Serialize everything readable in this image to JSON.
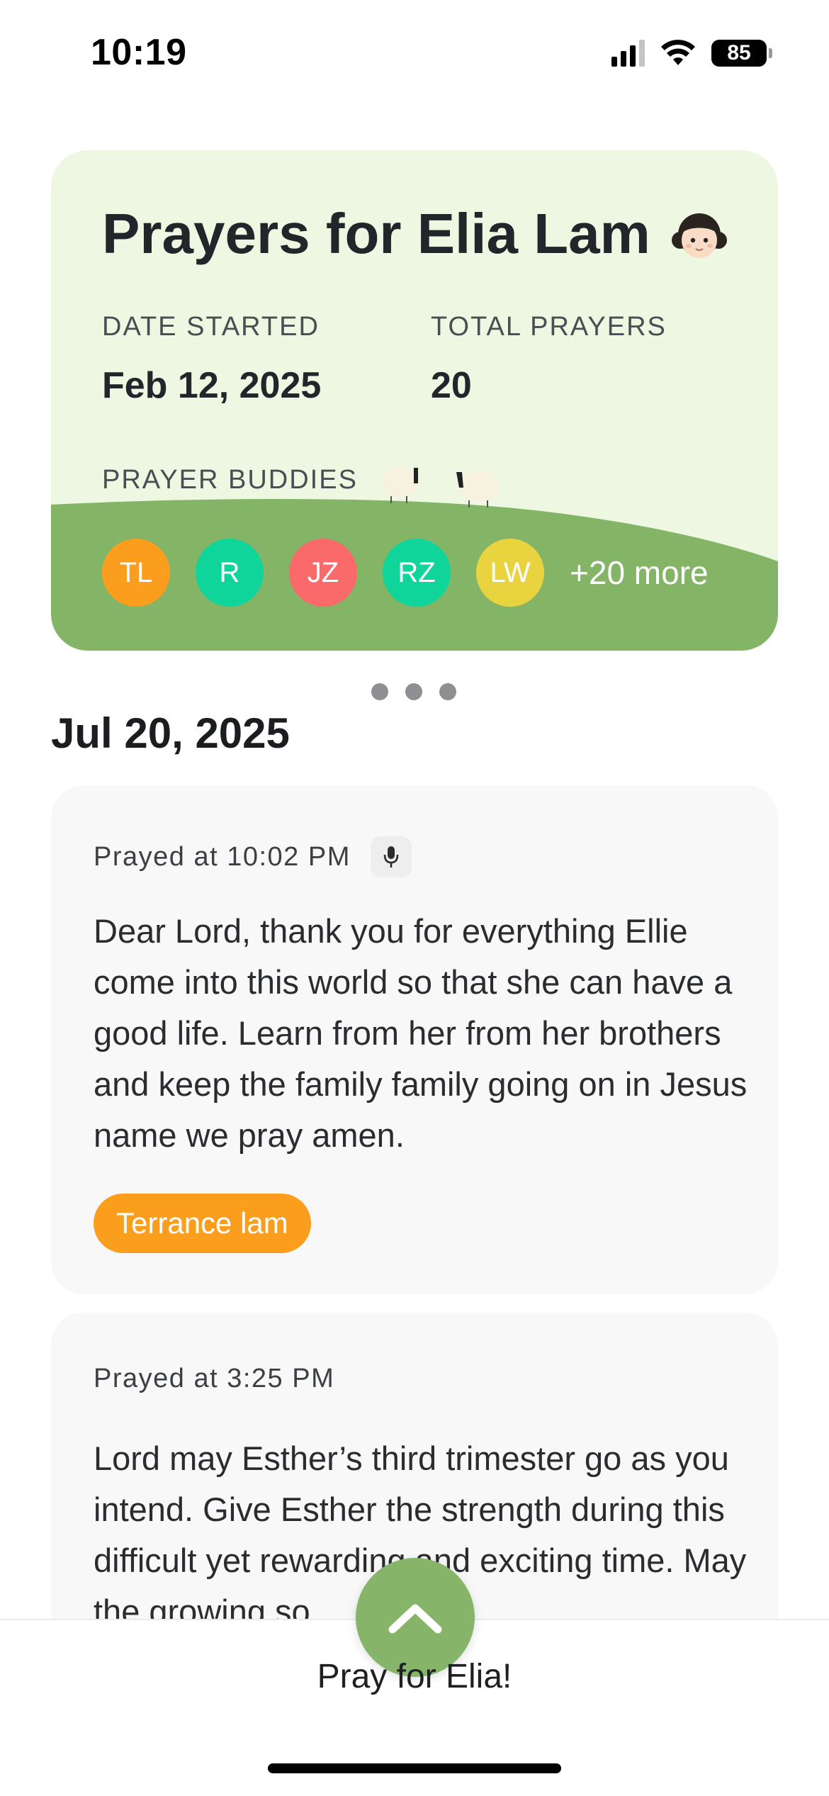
{
  "status_bar": {
    "time": "10:19",
    "battery": "85",
    "icons": [
      "cellular-signal-icon",
      "wifi-icon",
      "battery-icon"
    ]
  },
  "hero": {
    "title": "Prayers for Elia Lam",
    "title_emoji": "girl-emoji-icon",
    "date_started_label": "DATE STARTED",
    "date_started_value": "Feb 12, 2025",
    "total_prayers_label": "TOTAL PRAYERS",
    "total_prayers_value": "20",
    "buddies_label": "PRAYER BUDDIES",
    "buddies": [
      {
        "initials": "TL",
        "color": "#fb9e1e"
      },
      {
        "initials": "R",
        "color": "#0fd59a"
      },
      {
        "initials": "JZ",
        "color": "#fb6a6a"
      },
      {
        "initials": "RZ",
        "color": "#0fd59a"
      },
      {
        "initials": "LW",
        "color": "#e9d33f"
      }
    ],
    "more_buddies": "+20 more",
    "background_color": "#edf7e2",
    "hill_color": "#84b466"
  },
  "pager": {
    "pages": 3
  },
  "feed": {
    "date_header": "Jul 20, 2025",
    "prayers": [
      {
        "time": "Prayed at 10:02 PM",
        "has_voice": true,
        "text": "Dear Lord, thank you for everything Ellie come into this world so that she can have a good life. Learn from her from her brothers and keep the family family going on in Jesus name we pray amen.",
        "author": "Terrance lam",
        "author_color": "#fb9e1e"
      },
      {
        "time": "Prayed at 3:25 PM",
        "has_voice": false,
        "text": "Lord may Esther’s third trimester go as you intend. Give Esther the strength during this difficult yet rewarding and exciting time. May the growing so"
      }
    ]
  },
  "action": {
    "button_icon": "chevron-up-icon",
    "label": "Pray for Elia!",
    "button_color": "#86b56a"
  }
}
